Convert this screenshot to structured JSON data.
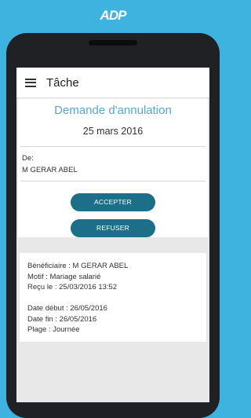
{
  "brand": {
    "logo_text": "ADP"
  },
  "appbar": {
    "menu_icon": "hamburger-menu-icon",
    "title": "Tâche"
  },
  "request": {
    "title": "Demande d'annulation",
    "date": "25 mars 2016",
    "from_label": "De:",
    "from_name": "M GERAR ABEL"
  },
  "actions": {
    "accept_label": "ACCEPTER",
    "reject_label": "REFUSER"
  },
  "details": {
    "beneficiary": "Bénéficiaire : M GERAR ABEL",
    "reason": "Motif : Mariage salarié",
    "received": "Reçu le : 25/03/2016 13:52",
    "start_date": "Date début : 26/05/2016",
    "end_date": "Date fin : 26/05/2016",
    "range": "Plage : Journée"
  },
  "colors": {
    "background": "#3fb3e0",
    "accent_title": "#5aa7cc",
    "button": "#1c6e89",
    "phone_body": "#202124"
  }
}
